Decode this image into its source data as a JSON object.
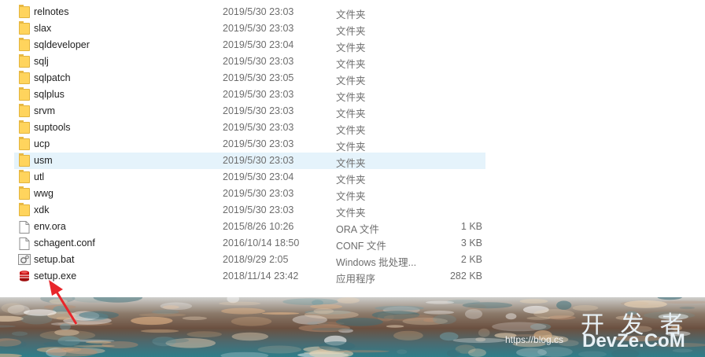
{
  "files": [
    {
      "name": "relnotes",
      "date": "2019/5/30 23:03",
      "type": "文件夹",
      "size": "",
      "icon": "folder-icon",
      "hover": false
    },
    {
      "name": "slax",
      "date": "2019/5/30 23:03",
      "type": "文件夹",
      "size": "",
      "icon": "folder-icon",
      "hover": false
    },
    {
      "name": "sqldeveloper",
      "date": "2019/5/30 23:04",
      "type": "文件夹",
      "size": "",
      "icon": "folder-icon",
      "hover": false
    },
    {
      "name": "sqlj",
      "date": "2019/5/30 23:03",
      "type": "文件夹",
      "size": "",
      "icon": "folder-icon",
      "hover": false
    },
    {
      "name": "sqlpatch",
      "date": "2019/5/30 23:05",
      "type": "文件夹",
      "size": "",
      "icon": "folder-icon",
      "hover": false
    },
    {
      "name": "sqlplus",
      "date": "2019/5/30 23:03",
      "type": "文件夹",
      "size": "",
      "icon": "folder-icon",
      "hover": false
    },
    {
      "name": "srvm",
      "date": "2019/5/30 23:03",
      "type": "文件夹",
      "size": "",
      "icon": "folder-icon",
      "hover": false
    },
    {
      "name": "suptools",
      "date": "2019/5/30 23:03",
      "type": "文件夹",
      "size": "",
      "icon": "folder-icon",
      "hover": false
    },
    {
      "name": "ucp",
      "date": "2019/5/30 23:03",
      "type": "文件夹",
      "size": "",
      "icon": "folder-icon",
      "hover": false
    },
    {
      "name": "usm",
      "date": "2019/5/30 23:03",
      "type": "文件夹",
      "size": "",
      "icon": "folder-icon",
      "hover": true
    },
    {
      "name": "utl",
      "date": "2019/5/30 23:04",
      "type": "文件夹",
      "size": "",
      "icon": "folder-icon",
      "hover": false
    },
    {
      "name": "wwg",
      "date": "2019/5/30 23:03",
      "type": "文件夹",
      "size": "",
      "icon": "folder-icon",
      "hover": false
    },
    {
      "name": "xdk",
      "date": "2019/5/30 23:03",
      "type": "文件夹",
      "size": "",
      "icon": "folder-icon",
      "hover": false
    },
    {
      "name": "env.ora",
      "date": "2015/8/26 10:26",
      "type": "ORA 文件",
      "size": "1 KB",
      "icon": "file-icon",
      "hover": false
    },
    {
      "name": "schagent.conf",
      "date": "2016/10/14 18:50",
      "type": "CONF 文件",
      "size": "3 KB",
      "icon": "file-icon",
      "hover": false
    },
    {
      "name": "setup.bat",
      "date": "2018/9/29 2:05",
      "type": "Windows 批处理...",
      "size": "2 KB",
      "icon": "batch-file-icon",
      "hover": false
    },
    {
      "name": "setup.exe",
      "date": "2018/11/14 23:42",
      "type": "应用程序",
      "size": "282 KB",
      "icon": "setup-exe-icon",
      "hover": false
    }
  ],
  "colors": {
    "hover_row": "#e5f3fb",
    "folder": "#ffd45d",
    "annotation_arrow": "#e8262b"
  },
  "watermark": {
    "url": "https://blog.cs",
    "brand_cn": "开 发 者",
    "brand_en": "DevZe.CoM"
  }
}
